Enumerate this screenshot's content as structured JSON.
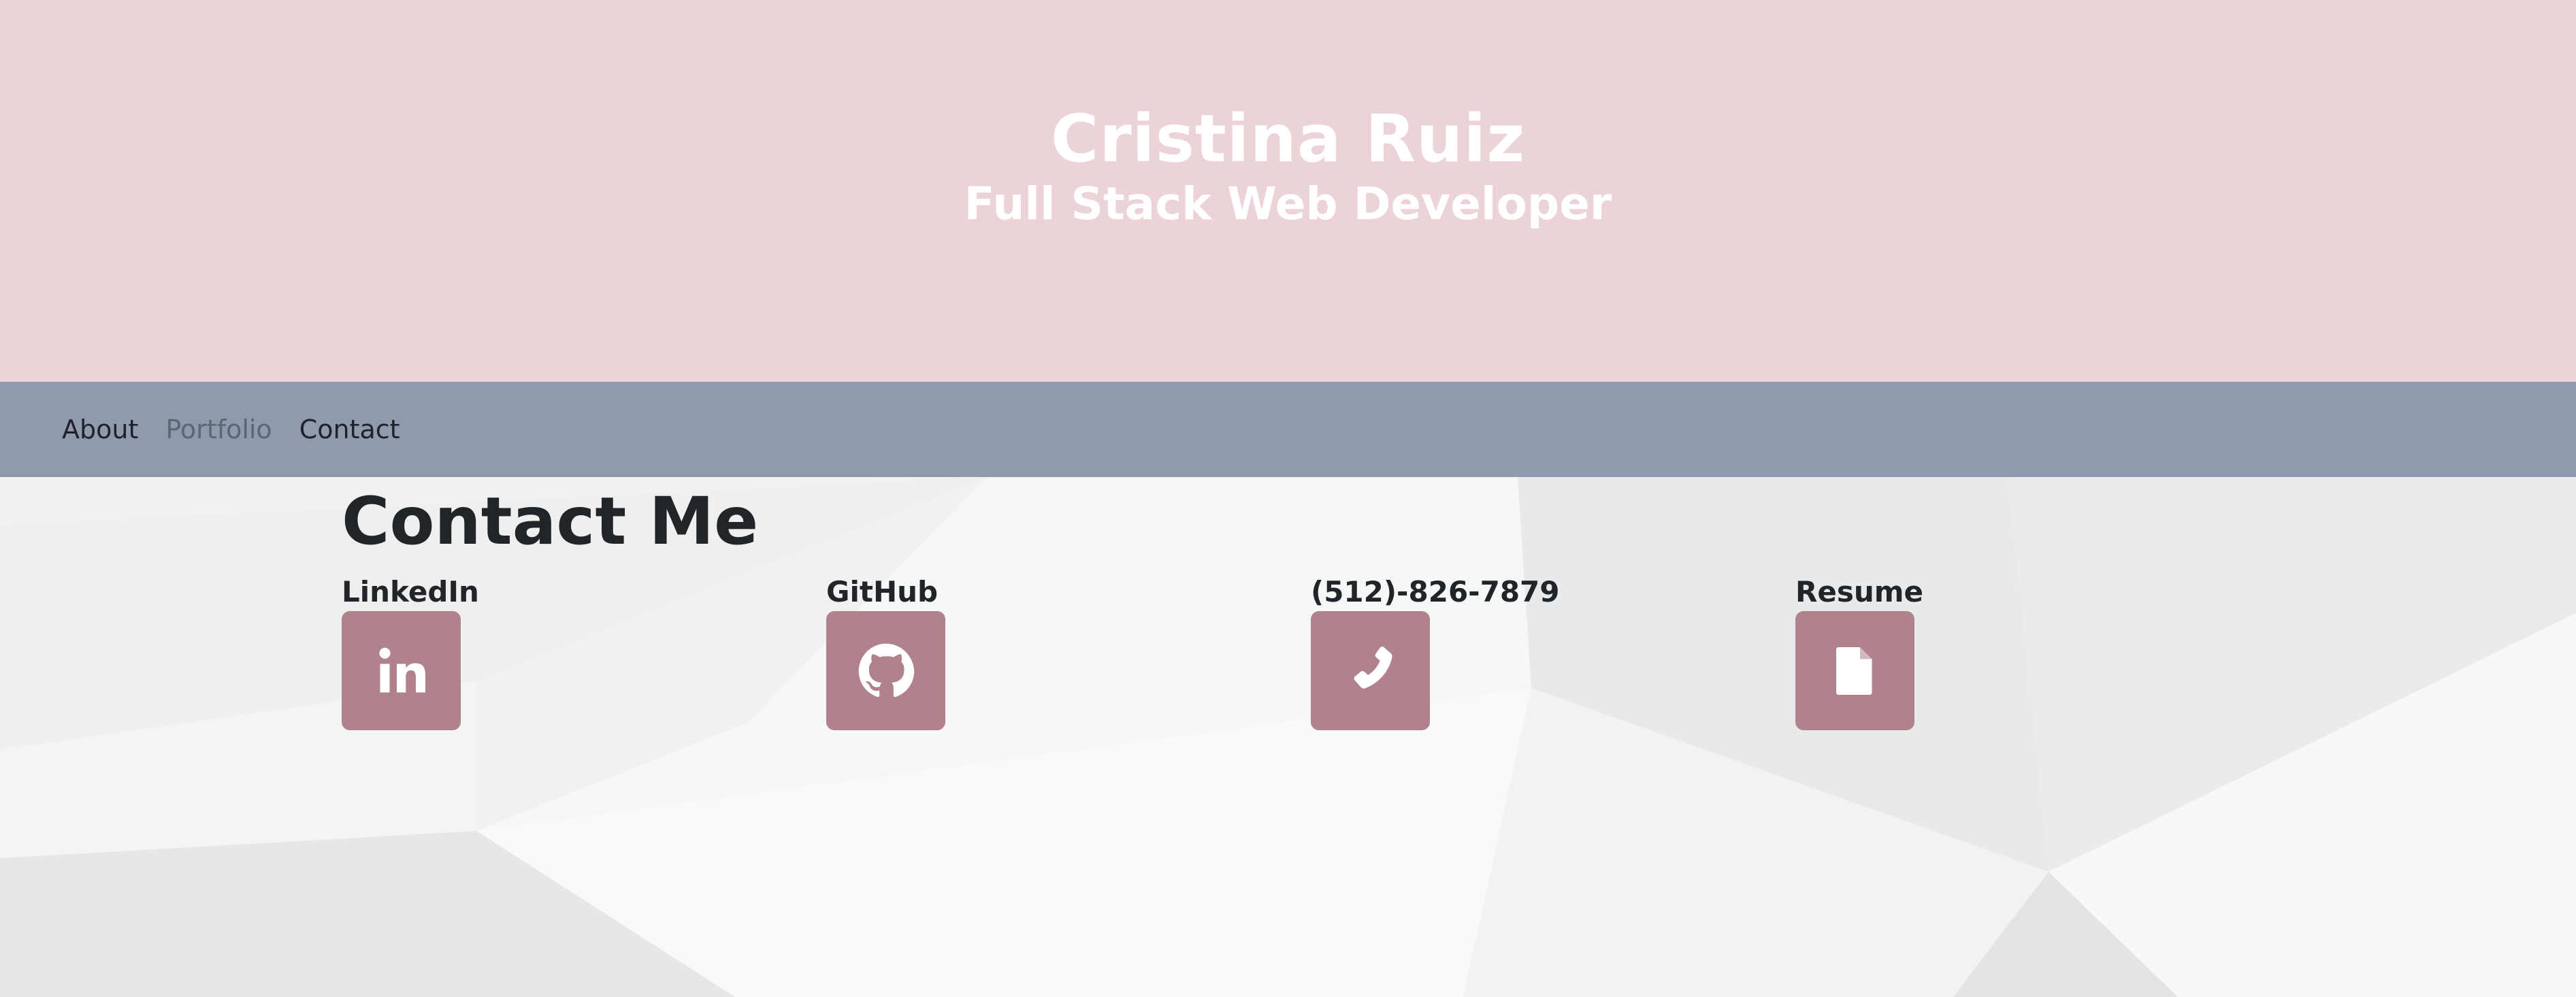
{
  "colors": {
    "header_bg": "#ecd3d7",
    "navbar_bg": "#8f9aae",
    "accent": "#b0828c",
    "nav_active": "#1f2329",
    "nav_muted": "#5e6573",
    "text_dark": "#212529"
  },
  "header": {
    "name": "Cristina Ruiz",
    "title": "Full Stack Web Developer"
  },
  "nav": {
    "items": [
      {
        "label": "About"
      },
      {
        "label": "Portfolio"
      },
      {
        "label": "Contact"
      }
    ]
  },
  "contact": {
    "heading": "Contact Me",
    "links": [
      {
        "label": "LinkedIn",
        "icon": "linkedin-icon"
      },
      {
        "label": "GitHub",
        "icon": "github-icon"
      },
      {
        "label": "(512)-826-7879",
        "icon": "phone-icon"
      },
      {
        "label": "Resume",
        "icon": "file-icon"
      }
    ]
  }
}
